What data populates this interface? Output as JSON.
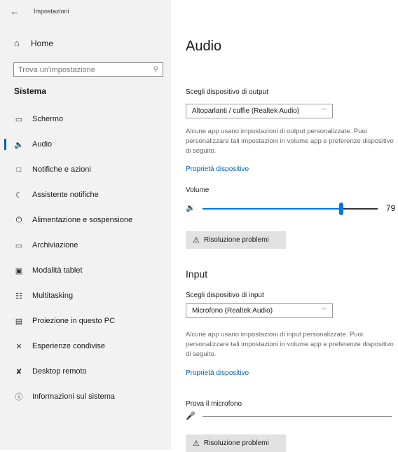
{
  "app_title": "Impostazioni",
  "home_label": "Home",
  "search_placeholder": "Trova un'impostazione",
  "section_header": "Sistema",
  "nav": [
    {
      "label": "Schermo",
      "icon": "monitor-icon"
    },
    {
      "label": "Audio",
      "icon": "speaker-icon",
      "active": true
    },
    {
      "label": "Notifiche e azioni",
      "icon": "notification-icon"
    },
    {
      "label": "Assistente notifiche",
      "icon": "moon-icon"
    },
    {
      "label": "Alimentazione e sospensione",
      "icon": "power-icon"
    },
    {
      "label": "Archiviazione",
      "icon": "storage-icon"
    },
    {
      "label": "Modalità tablet",
      "icon": "tablet-icon"
    },
    {
      "label": "Multitasking",
      "icon": "multitasking-icon"
    },
    {
      "label": "Proiezione in questo PC",
      "icon": "projection-icon"
    },
    {
      "label": "Esperienze condivise",
      "icon": "shared-icon"
    },
    {
      "label": "Desktop remoto",
      "icon": "remote-desktop-icon"
    },
    {
      "label": "Informazioni sul sistema",
      "icon": "info-icon"
    }
  ],
  "main": {
    "title": "Audio",
    "output": {
      "label": "Scegli dispositivo di output",
      "selected": "Altoparlanti / cuffie (Realtek Audio)",
      "description": "Alcune app usano impostazioni di output personalizzate. Puoi personalizzare tali impostazioni in volume app e preferenze dispositivo di seguito.",
      "link": "Proprietà dispositivo",
      "volume_label": "Volume",
      "volume": 79,
      "troubleshoot": "Risoluzione problemi"
    },
    "input": {
      "header": "Input",
      "label": "Scegli dispositivo di input",
      "selected": "Microfono (Realtek Audio)",
      "description": "Alcune app usano impostazioni di input personalizzate. Puoi personalizzare tali impostazioni in volume app e preferenze dispositivo di seguito.",
      "link": "Proprietà dispositivo",
      "mic_test_label": "Prova il microfono",
      "mic_level": 0,
      "troubleshoot": "Risoluzione problemi"
    }
  },
  "colors": {
    "accent": "#0078d7",
    "link": "#0063b1",
    "sidebar_bg": "#f2f2f2"
  }
}
